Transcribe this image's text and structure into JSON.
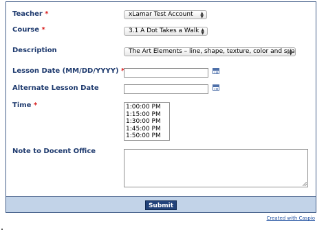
{
  "form": {
    "teacher": {
      "label": "Teacher",
      "required": "*",
      "value": "xLamar Test Account"
    },
    "course": {
      "label": "Course",
      "required": "*",
      "value": "3.1 A Dot Takes a Walk"
    },
    "description": {
      "label": "Description",
      "value": "The Art Elements – line, shape, texture, color and space – a"
    },
    "lesson_date": {
      "label": "Lesson Date (MM/DD/YYYY)",
      "required": "*",
      "value": ""
    },
    "alternate_lesson_date": {
      "label": "Alternate Lesson Date",
      "value": ""
    },
    "time": {
      "label": "Time",
      "required": "*",
      "options": [
        "1:00:00 PM",
        "1:15:00 PM",
        "1:30:00 PM",
        "1:45:00 PM",
        "1:50:00 PM"
      ]
    },
    "note": {
      "label": "Note to Docent Office",
      "value": ""
    },
    "submit_label": "Submit"
  },
  "footer": {
    "caspio_link": "Created with Caspio"
  },
  "icons": {
    "calendar": "calendar-icon",
    "select_arrows": "select-arrows-icon"
  },
  "colors": {
    "label": "#1e3a6e",
    "required": "#d81e1e",
    "border": "#3e5a86",
    "footer_bg": "#c2d3e8",
    "button": "#23437a",
    "link": "#1f4fa0"
  }
}
